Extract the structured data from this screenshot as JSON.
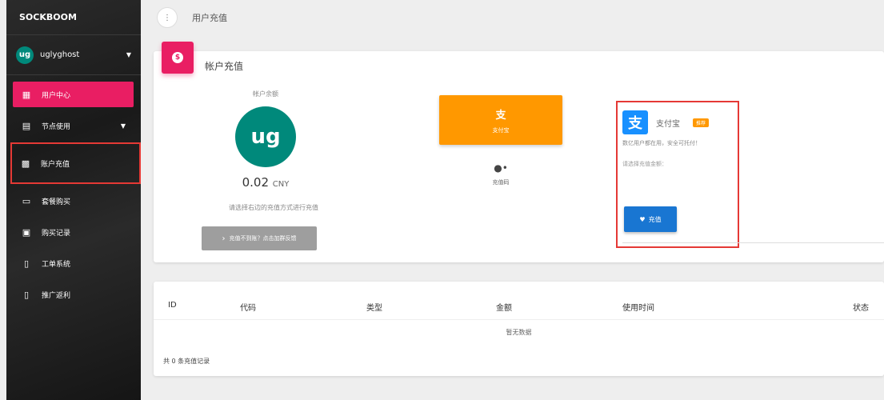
{
  "sidebar": {
    "brand": "SOCKBOOM",
    "user": {
      "avatar": "ug",
      "name": "uglyghost"
    },
    "items": [
      {
        "label": "用户中心",
        "icon": "dashboard-icon"
      },
      {
        "label": "节点使用",
        "icon": "grid-icon"
      },
      {
        "label": "账户充值",
        "icon": "widgets-icon"
      },
      {
        "label": "套餐购买",
        "icon": "store-icon"
      },
      {
        "label": "购买记录",
        "icon": "receipt-icon"
      },
      {
        "label": "工单系统",
        "icon": "clipboard-icon"
      },
      {
        "label": "推广返利",
        "icon": "clipboard-icon"
      }
    ]
  },
  "topbar": {
    "menu_icon": "⋮",
    "title": "用户充值"
  },
  "recharge": {
    "title": "帐户充值",
    "balance_label": "帐户余额",
    "avatar": "ug",
    "amount": "0.02",
    "currency": "CNY",
    "hint": "请选择右边的充值方式进行充值",
    "help_button": "充值不到账？点击加群反馈",
    "method_glyph": "支",
    "method_label": "支付宝",
    "code_label": "充值码",
    "panel": {
      "logo": "支",
      "name": "支付宝",
      "tag": "推荐",
      "desc": "数亿用户都在用，安全可托付！",
      "amount_label": "请选择充值金额：",
      "button": "充值"
    }
  },
  "records": {
    "headers": [
      "ID",
      "代码",
      "类型",
      "金额",
      "使用时间",
      "状态"
    ],
    "empty": "暂无数据",
    "count": "共 0 条充值记录"
  },
  "colors": {
    "accent": "#e91e63",
    "teal": "#00897b",
    "orange": "#ff9800",
    "blue": "#1976d2",
    "highlight": "#e53935"
  }
}
